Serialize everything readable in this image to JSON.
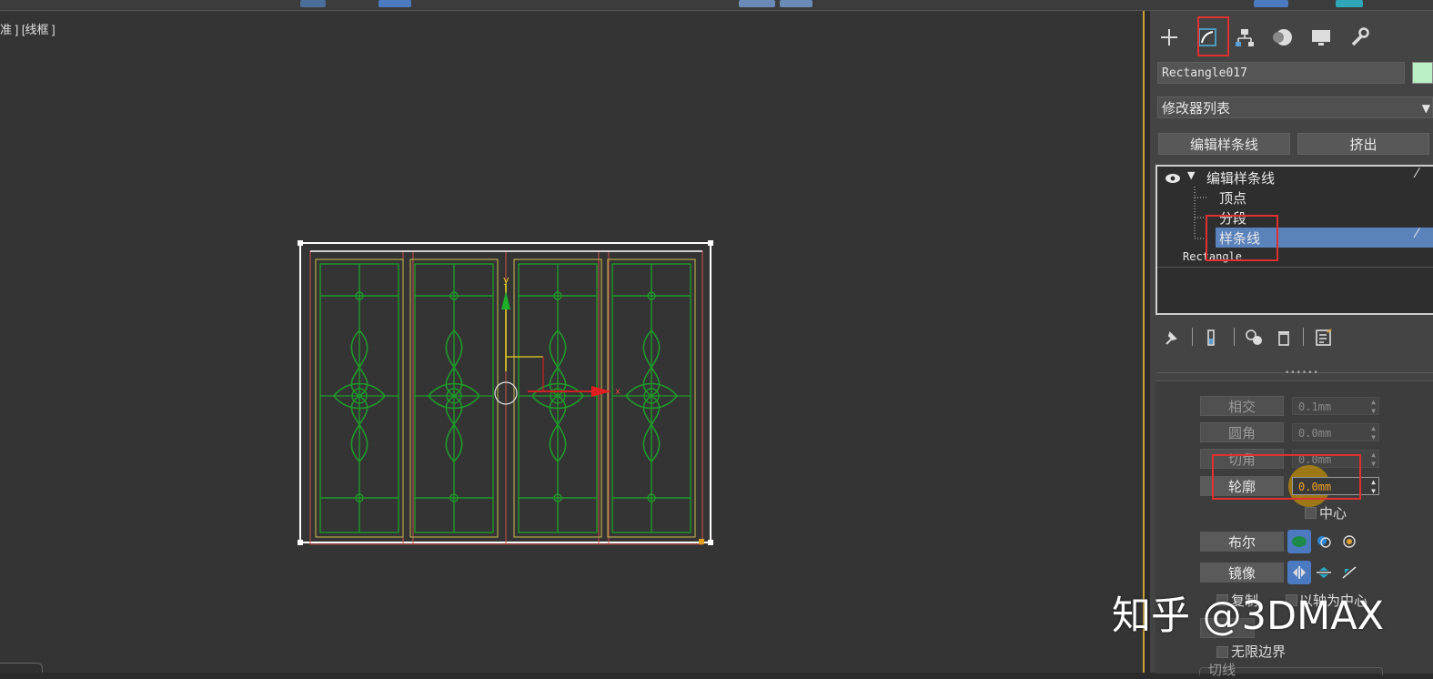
{
  "viewport": {
    "label": "准 ] [线框 ]",
    "axis_y": "y",
    "axis_x": "x"
  },
  "panel": {
    "tabs": [
      {
        "icon": "create-icon"
      },
      {
        "icon": "modify-icon"
      },
      {
        "icon": "hierarchy-icon"
      },
      {
        "icon": "motion-icon"
      },
      {
        "icon": "display-icon"
      },
      {
        "icon": "utilities-icon"
      }
    ],
    "object_name": "Rectangle017",
    "object_color": "#b9f0c4",
    "modifier_list": "修改器列表",
    "quick_buttons": [
      "编辑样条线",
      "挤出"
    ],
    "stack": {
      "root": "编辑样条线",
      "children": [
        "顶点",
        "分段",
        "样条线"
      ],
      "base": "Rectangle"
    },
    "params": {
      "intersect": {
        "label": "相交",
        "value": "0.1mm"
      },
      "fillet": {
        "label": "圆角",
        "value": "0.0mm"
      },
      "chamfer": {
        "label": "切角",
        "value": "0.0mm"
      },
      "outline": {
        "label": "轮廓",
        "value": "0.0mm"
      },
      "center_label": "中心",
      "boolean_label": "布尔",
      "mirror_label": "镜像",
      "copy_label": "复制",
      "about_pivot_label": "以轴为中心",
      "infinite_bounds_label": "无限边界",
      "tangent_label": "切线"
    }
  },
  "watermark": "知乎 @3DMAX",
  "colors": {
    "selection_highlight": "#5a82bb",
    "annotation_red": "#e03030",
    "viewport_border": "#c9a23a",
    "spline_green": "#1f9a2a"
  }
}
